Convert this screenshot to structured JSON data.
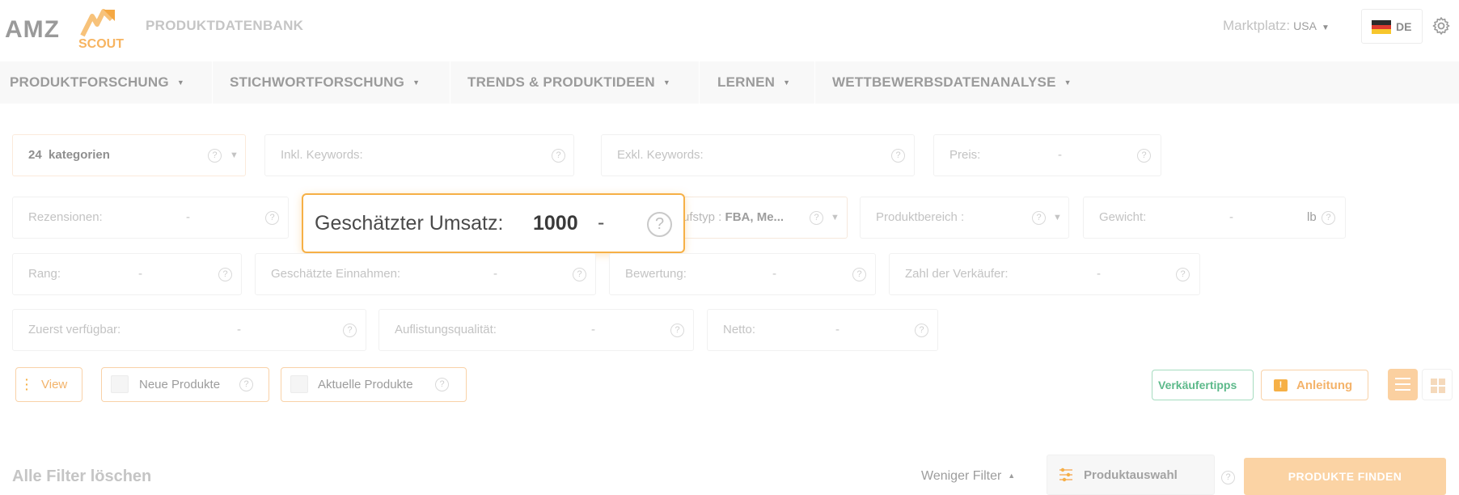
{
  "header": {
    "logo_top": "AMZ",
    "logo_bottom": "SCOUT",
    "app_title": "PRODUKTDATENBANK",
    "marketplace_label": "Marktplatz:",
    "marketplace_value": "USA",
    "language": "DE"
  },
  "nav": {
    "items": [
      {
        "label": "PRODUKTFORSCHUNG"
      },
      {
        "label": "STICHWORTFORSCHUNG"
      },
      {
        "label": "TRENDS & PRODUKTIDEEN"
      },
      {
        "label": "LERNEN"
      },
      {
        "label": "WETTBEWERBSDATENANALYSE"
      }
    ]
  },
  "filters": {
    "categories": {
      "count": "24",
      "label": "kategorien"
    },
    "incl_keywords": "Inkl. Keywords:",
    "excl_keywords": "Exkl. Keywords:",
    "price": "Preis:",
    "reviews": "Rezensionen:",
    "sales_type": {
      "label": "ufstyp :",
      "value": "FBA, Me..."
    },
    "product_tier": "Produktbereich :",
    "weight": {
      "label": "Gewicht:",
      "unit": "lb"
    },
    "rank": "Rang:",
    "est_revenue": "Geschätzte Einnahmen:",
    "rating": "Bewertung:",
    "sellers": "Zahl der Verkäufer:",
    "first_available": "Zuerst verfügbar:",
    "listing_quality": "Auflistungsqualität:",
    "net": "Netto:",
    "dash": "-",
    "help": "?"
  },
  "popup": {
    "label": "Geschätzter Umsatz:",
    "value": "1000",
    "dash": "-"
  },
  "toggles": {
    "view": "View",
    "new_products": "Neue Produkte",
    "current_products": "Aktuelle Produkte"
  },
  "actions": {
    "seller_tips": "Verkäufertipps",
    "guide": "Anleitung"
  },
  "bottom": {
    "clear_all": "Alle Filter löschen",
    "fewer_filters": "Weniger Filter",
    "product_selection": "Produktauswahl",
    "find_products": "PRODUKTE FINDEN"
  },
  "colors": {
    "accent": "#f6b046",
    "green": "#4caf7d",
    "button_disabled": "#fbd3a4"
  }
}
